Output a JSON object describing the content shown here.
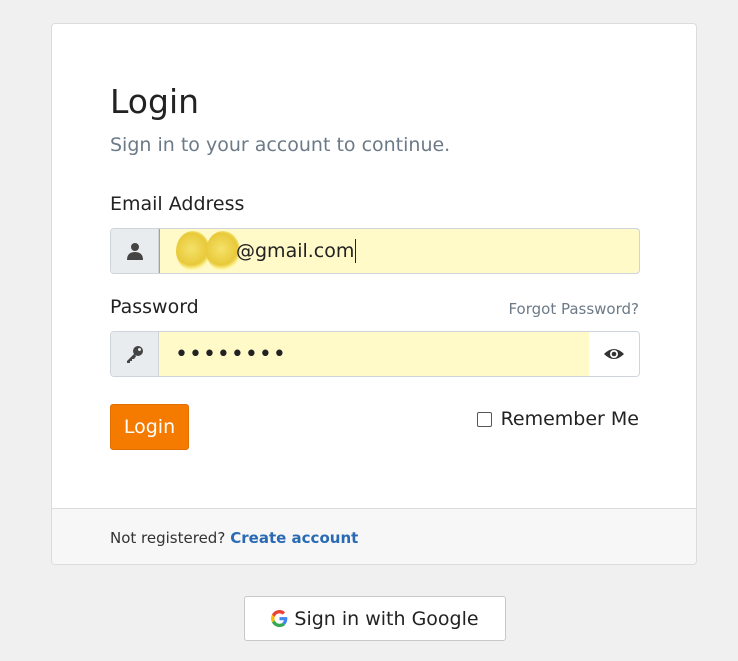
{
  "login_card": {
    "title": "Login",
    "subtitle": "Sign in to your account to continue.",
    "email": {
      "label": "Email Address",
      "value_suffix": "@gmail.com",
      "icon": "user-icon"
    },
    "password": {
      "label": "Password",
      "forgot_label": "Forgot Password?",
      "value": "••••••••",
      "icon": "key-icon",
      "toggle_icon": "eye-icon"
    },
    "login_button": "Login",
    "remember_label": "Remember Me"
  },
  "footer": {
    "prompt": "Not registered?",
    "link": "Create account"
  },
  "google_button": {
    "label": "Sign in with Google",
    "icon": "google-g-icon"
  },
  "colors": {
    "accent": "#f47b00",
    "link": "#2a6ab4",
    "autofill": "#fffac8"
  }
}
